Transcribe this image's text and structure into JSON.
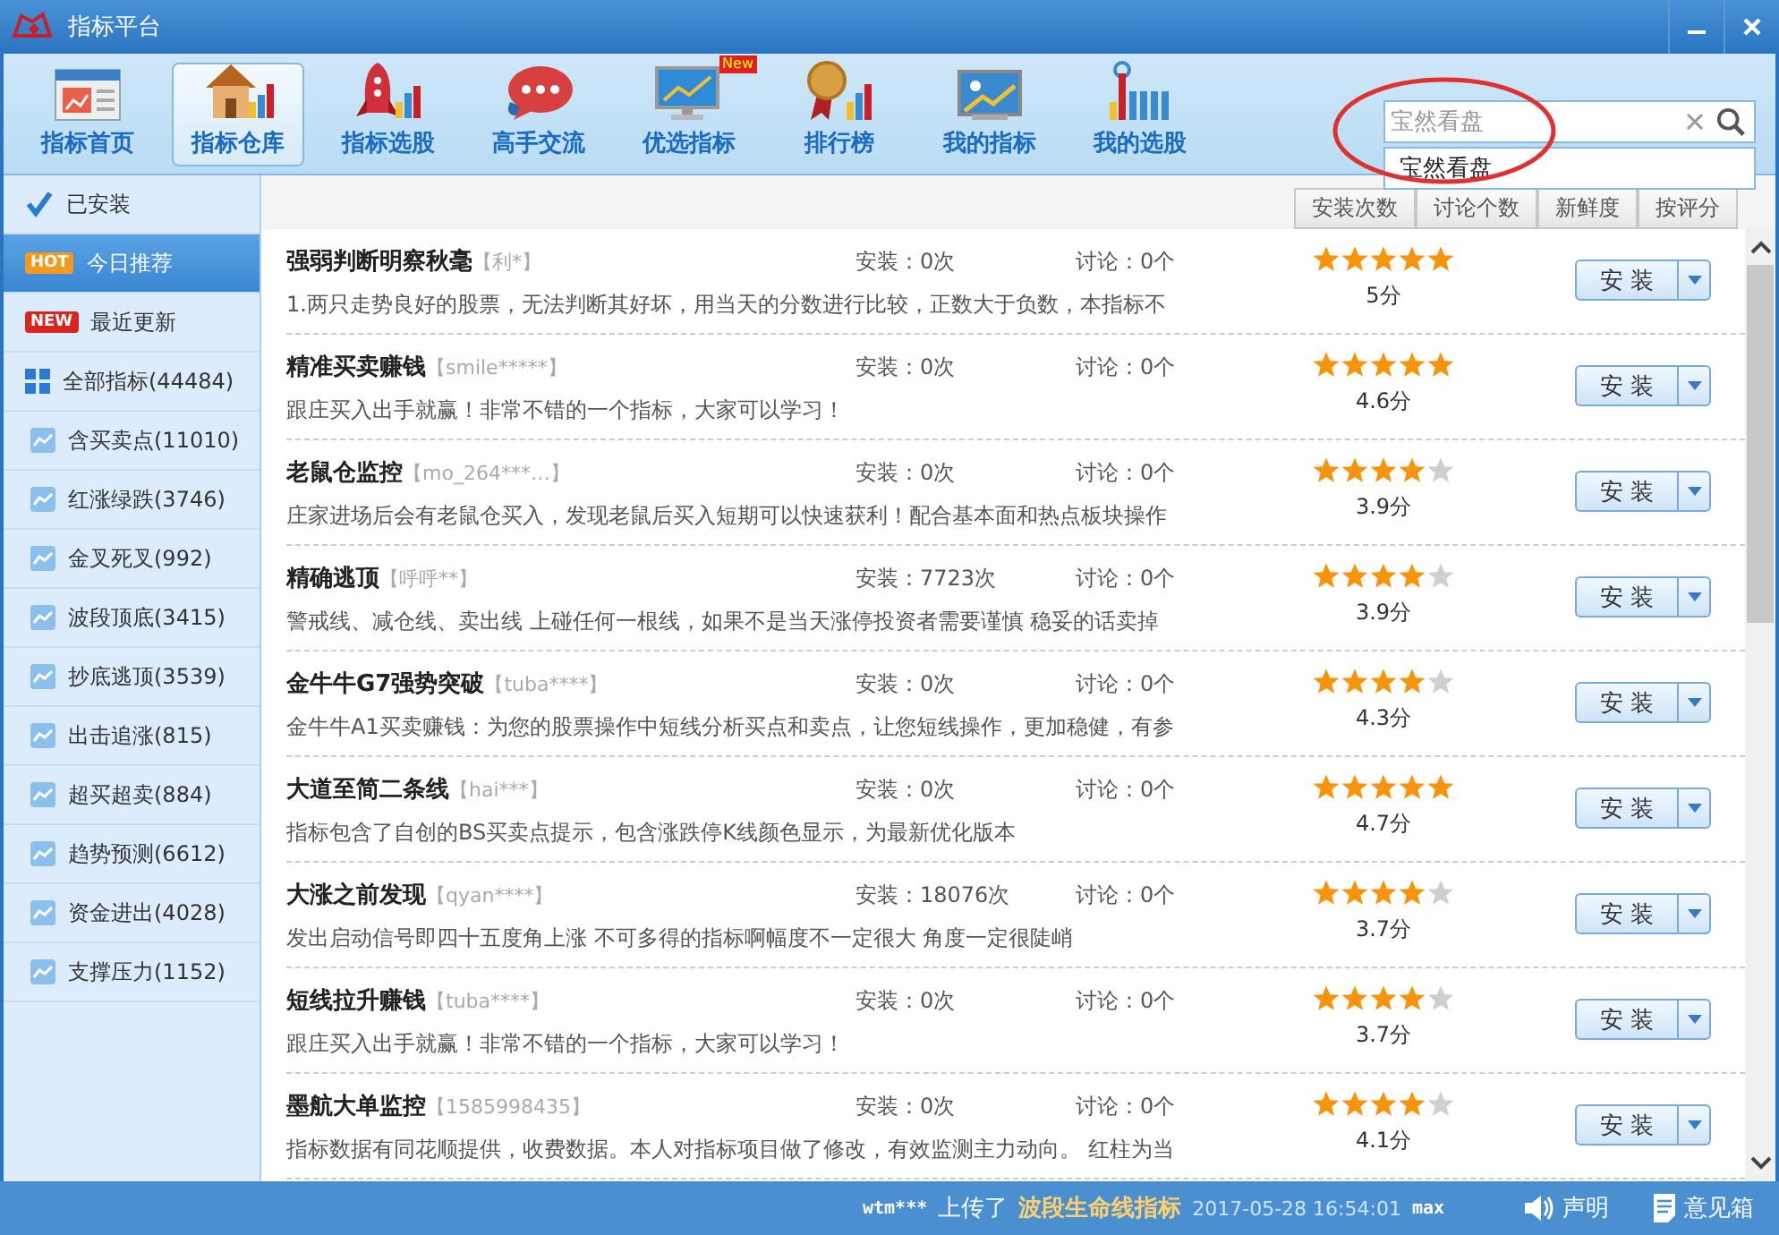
{
  "window": {
    "title": "指标平台"
  },
  "toolbar": [
    {
      "label": "指标首页",
      "kind": "home",
      "selected": false
    },
    {
      "label": "指标仓库",
      "kind": "house",
      "selected": true
    },
    {
      "label": "指标选股",
      "kind": "rocket",
      "selected": false
    },
    {
      "label": "高手交流",
      "kind": "chat",
      "selected": false
    },
    {
      "label": "优选指标",
      "kind": "monitor",
      "selected": false,
      "badge": "New"
    },
    {
      "label": "排行榜",
      "kind": "medal",
      "selected": false
    },
    {
      "label": "我的指标",
      "kind": "picture",
      "selected": false
    },
    {
      "label": "我的选股",
      "kind": "bars",
      "selected": false
    }
  ],
  "search": {
    "value": "宝然看盘",
    "suggestions": [
      "宝然看盘"
    ]
  },
  "sidebar": {
    "items": [
      {
        "label": "已安装",
        "kind": "check",
        "selected": false
      },
      {
        "label": "今日推荐",
        "kind": "badge",
        "badge": "HOT",
        "color": "#f39a1e",
        "selected": true
      },
      {
        "label": "最近更新",
        "kind": "badge",
        "badge": "NEW",
        "color": "#d8261e",
        "selected": false
      },
      {
        "label": "全部指标(44484)",
        "kind": "grid",
        "selected": false
      },
      {
        "label": "含买卖点(11010)",
        "kind": "chart",
        "selected": false
      },
      {
        "label": "红涨绿跌(3746)",
        "kind": "chart",
        "selected": false
      },
      {
        "label": "金叉死叉(992)",
        "kind": "chart",
        "selected": false
      },
      {
        "label": "波段顶底(3415)",
        "kind": "chart",
        "selected": false
      },
      {
        "label": "抄底逃顶(3539)",
        "kind": "chart",
        "selected": false
      },
      {
        "label": "出击追涨(815)",
        "kind": "chart",
        "selected": false
      },
      {
        "label": "超买超卖(884)",
        "kind": "chart",
        "selected": false
      },
      {
        "label": "趋势预测(6612)",
        "kind": "chart",
        "selected": false
      },
      {
        "label": "资金进出(4028)",
        "kind": "chart",
        "selected": false
      },
      {
        "label": "支撑压力(1152)",
        "kind": "chart",
        "selected": false
      }
    ]
  },
  "sort_buttons": [
    "安装次数",
    "讨论个数",
    "新鲜度",
    "按评分"
  ],
  "indicators": [
    {
      "name": "强弱判断明察秋毫",
      "author": "【利*】",
      "installs": "安装：0次",
      "comments": "讨论：0个",
      "stars": 5,
      "score": "5分",
      "description": "1.两只走势良好的股票，无法判断其好坏，用当天的分数进行比较，正数大于负数，本指标不",
      "button": "安 装"
    },
    {
      "name": "精准买卖赚钱",
      "author": "【smile*****】",
      "installs": "安装：0次",
      "comments": "讨论：0个",
      "stars": 5,
      "score": "4.6分",
      "description": "跟庄买入出手就赢！非常不错的一个指标，大家可以学习！",
      "button": "安 装"
    },
    {
      "name": "老鼠仓监控",
      "author": "【mo_264***…】",
      "installs": "安装：0次",
      "comments": "讨论：0个",
      "stars": 4,
      "score": "3.9分",
      "description": "庄家进场后会有老鼠仓买入，发现老鼠后买入短期可以快速获利！配合基本面和热点板块操作",
      "button": "安 装"
    },
    {
      "name": "精确逃顶",
      "author": "【呼呼**】",
      "installs": "安装：7723次",
      "comments": "讨论：0个",
      "stars": 4,
      "score": "3.9分",
      "description": "警戒线、减仓线、卖出线 上碰任何一根线，如果不是当天涨停投资者需要谨慎 稳妥的话卖掉",
      "button": "安 装"
    },
    {
      "name": "金牛牛G7强势突破",
      "author": "【tuba****】",
      "installs": "安装：0次",
      "comments": "讨论：0个",
      "stars": 4,
      "score": "4.3分",
      "description": "金牛牛A1买卖赚钱：为您的股票操作中短线分析买点和卖点，让您短线操作，更加稳健，有参",
      "button": "安 装"
    },
    {
      "name": "大道至简二条线",
      "author": "【hai***】",
      "installs": "安装：0次",
      "comments": "讨论：0个",
      "stars": 5,
      "score": "4.7分",
      "description": "指标包含了自创的BS买卖点提示，包含涨跌停K线颜色显示，为最新优化版本",
      "button": "安 装"
    },
    {
      "name": "大涨之前发现",
      "author": "【qyan****】",
      "installs": "安装：18076次",
      "comments": "讨论：0个",
      "stars": 4,
      "score": "3.7分",
      "description": "发出启动信号即四十五度角上涨 不可多得的指标啊幅度不一定很大 角度一定很陡峭",
      "button": "安 装"
    },
    {
      "name": "短线拉升赚钱",
      "author": "【tuba****】",
      "installs": "安装：0次",
      "comments": "讨论：0个",
      "stars": 4,
      "score": "3.7分",
      "description": "跟庄买入出手就赢！非常不错的一个指标，大家可以学习！",
      "button": "安 装"
    },
    {
      "name": "墨航大单监控",
      "author": "【1585998435】",
      "installs": "安装：0次",
      "comments": "讨论：0个",
      "stars": 4,
      "score": "4.1分",
      "description": "指标数据有同花顺提供，收费数据。本人对指标项目做了修改，有效监测主力动向。 红柱为当",
      "button": "安 装"
    }
  ],
  "status_bar": {
    "user": "wtm***",
    "action": "上传了",
    "indicator": "波段生命线指标",
    "time": "2017-05-28 16:54:01",
    "tail": "max",
    "links": [
      {
        "label": "声明",
        "kind": "speaker"
      },
      {
        "label": "意见箱",
        "kind": "note"
      }
    ]
  }
}
